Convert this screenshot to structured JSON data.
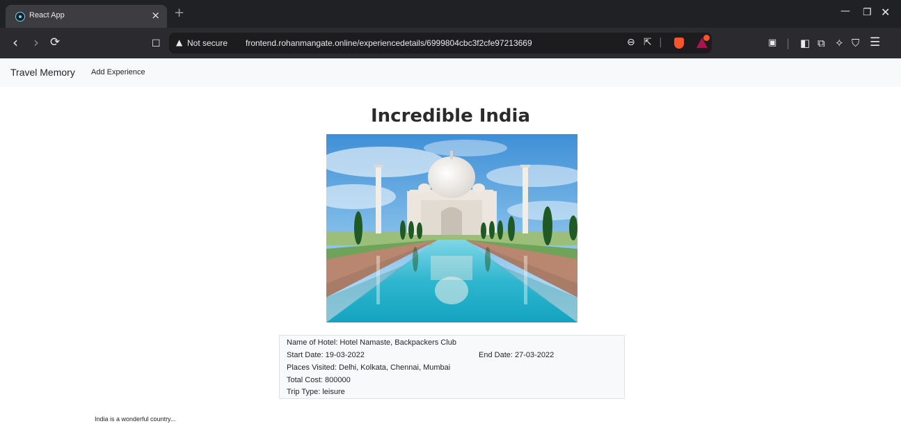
{
  "browser": {
    "tab_title": "React App",
    "tab_close": "×",
    "new_tab": "+",
    "address": {
      "security_label": "Not secure",
      "url": "frontend.rohanmangate.online/experiencedetails/6999804cbc3f2cfe97213669"
    }
  },
  "navbar": {
    "brand": "Travel Memory",
    "link": "Add Experience"
  },
  "experience": {
    "title": "Incredible India",
    "image_alt": "Taj Mahal",
    "hotel": "Name of Hotel: Hotel Namaste, Backpackers Club",
    "start_date": "Start Date: 19-03-2022",
    "end_date": "End Date: 27-03-2022",
    "places": "Places Visited: Delhi, Kolkata, Chennai, Mumbai",
    "cost": "Total Cost: 800000",
    "trip_type": "Trip Type: leisure",
    "description": "India is a wonderful country..."
  },
  "colors": {
    "tabbar": "#202124",
    "toolbar": "#2b2b2f",
    "navbar": "#f8f9fa",
    "react_blue": "#61dafb",
    "brave_orange": "#fb542b"
  }
}
